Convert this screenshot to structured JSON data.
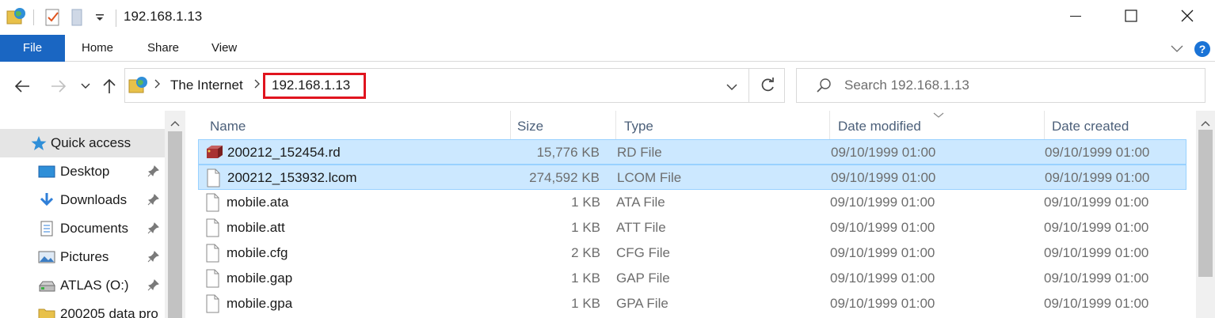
{
  "window": {
    "title": "192.168.1.13",
    "quick_access_toolbar": [
      "network-folder-icon",
      "properties-icon",
      "new-folder-icon",
      "customize-dropdown-icon"
    ],
    "controls": [
      "minimize-icon",
      "maximize-icon",
      "close-icon"
    ]
  },
  "ribbon": {
    "tabs": [
      {
        "label": "File",
        "active": true
      },
      {
        "label": "Home"
      },
      {
        "label": "Share"
      },
      {
        "label": "View"
      }
    ],
    "help_label": "?"
  },
  "nav": {
    "back_icon": "back-arrow-icon",
    "forward_icon": "forward-arrow-icon",
    "recent_icon": "recent-locations-icon",
    "up_icon": "up-arrow-icon"
  },
  "address": {
    "breadcrumbs": [
      {
        "label": "The Internet"
      },
      {
        "label": "192.168.1.13",
        "highlighted": true
      }
    ]
  },
  "search": {
    "placeholder": "Search 192.168.1.13"
  },
  "sidebar": {
    "items": [
      {
        "label": "Quick access",
        "icon": "star-icon",
        "selected": true
      },
      {
        "label": "Desktop",
        "icon": "desktop-icon",
        "pinned": true
      },
      {
        "label": "Downloads",
        "icon": "download-icon",
        "pinned": true
      },
      {
        "label": "Documents",
        "icon": "documents-icon",
        "pinned": true
      },
      {
        "label": "Pictures",
        "icon": "pictures-icon",
        "pinned": true
      },
      {
        "label": "ATLAS (O:)",
        "icon": "drive-icon",
        "pinned": true
      },
      {
        "label": "200205 data pro",
        "icon": "folder-icon"
      }
    ]
  },
  "columns": [
    "Name",
    "Size",
    "Type",
    "Date modified",
    "Date created"
  ],
  "files": [
    {
      "name": "200212_152454.rd",
      "size": "15,776 KB",
      "type": "RD File",
      "modified": "09/10/1999 01:00",
      "created": "09/10/1999 01:00",
      "selected": true,
      "icon": "rd-file-icon"
    },
    {
      "name": "200212_153932.lcom",
      "size": "274,592 KB",
      "type": "LCOM File",
      "modified": "09/10/1999 01:00",
      "created": "09/10/1999 01:00",
      "selected": true,
      "icon": "file-icon"
    },
    {
      "name": "mobile.ata",
      "size": "1 KB",
      "type": "ATA File",
      "modified": "09/10/1999 01:00",
      "created": "09/10/1999 01:00",
      "icon": "file-icon"
    },
    {
      "name": "mobile.att",
      "size": "1 KB",
      "type": "ATT File",
      "modified": "09/10/1999 01:00",
      "created": "09/10/1999 01:00",
      "icon": "file-icon"
    },
    {
      "name": "mobile.cfg",
      "size": "2 KB",
      "type": "CFG File",
      "modified": "09/10/1999 01:00",
      "created": "09/10/1999 01:00",
      "icon": "file-icon"
    },
    {
      "name": "mobile.gap",
      "size": "1 KB",
      "type": "GAP File",
      "modified": "09/10/1999 01:00",
      "created": "09/10/1999 01:00",
      "icon": "file-icon"
    },
    {
      "name": "mobile.gpa",
      "size": "1 KB",
      "type": "GPA File",
      "modified": "09/10/1999 01:00",
      "created": "09/10/1999 01:00",
      "icon": "file-icon"
    }
  ],
  "colors": {
    "file_tab": "#1a66c2",
    "selection_bg": "#cce8ff",
    "selection_border": "#99d1ff",
    "highlight_box": "#e0141e",
    "header_text": "#4c607a"
  }
}
